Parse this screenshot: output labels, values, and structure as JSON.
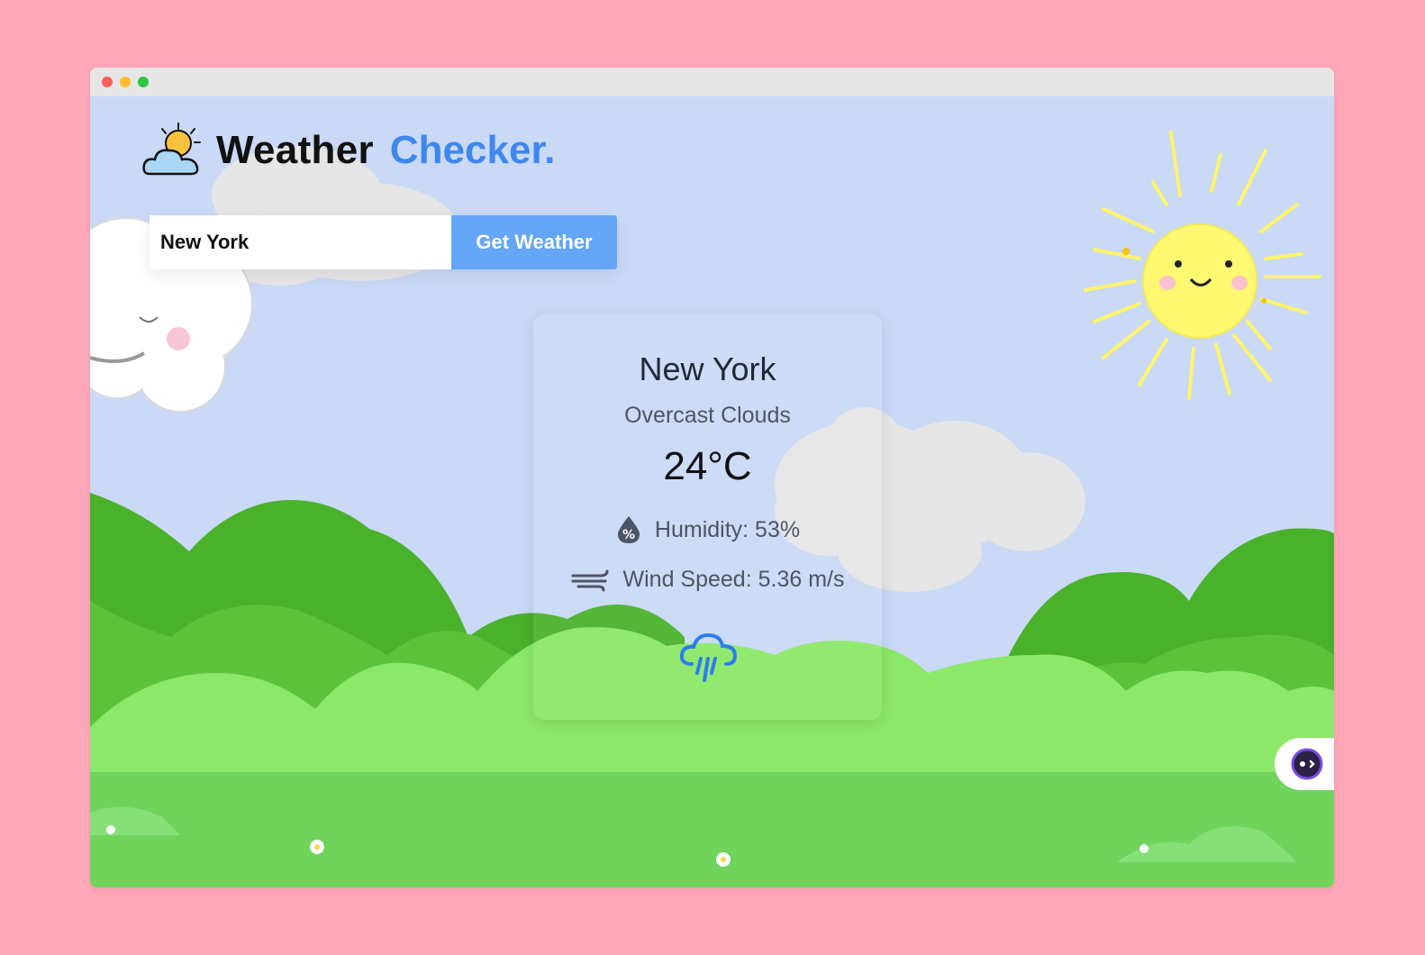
{
  "app": {
    "title_main": "Weather",
    "title_accent": "Checker."
  },
  "search": {
    "value": "New York",
    "button_label": "Get Weather"
  },
  "weather": {
    "city": "New York",
    "description": "Overcast Clouds",
    "temperature": "24°C",
    "humidity": "Humidity: 53%",
    "wind": "Wind Speed: 5.36 m/s",
    "condition_icon": "rain-cloud-icon"
  },
  "colors": {
    "page_background": "#ffa6b8",
    "sky": "#c9d9f6",
    "accent": "#3f87f0",
    "button": "#64a6f7",
    "grass": "#6fd35c"
  }
}
